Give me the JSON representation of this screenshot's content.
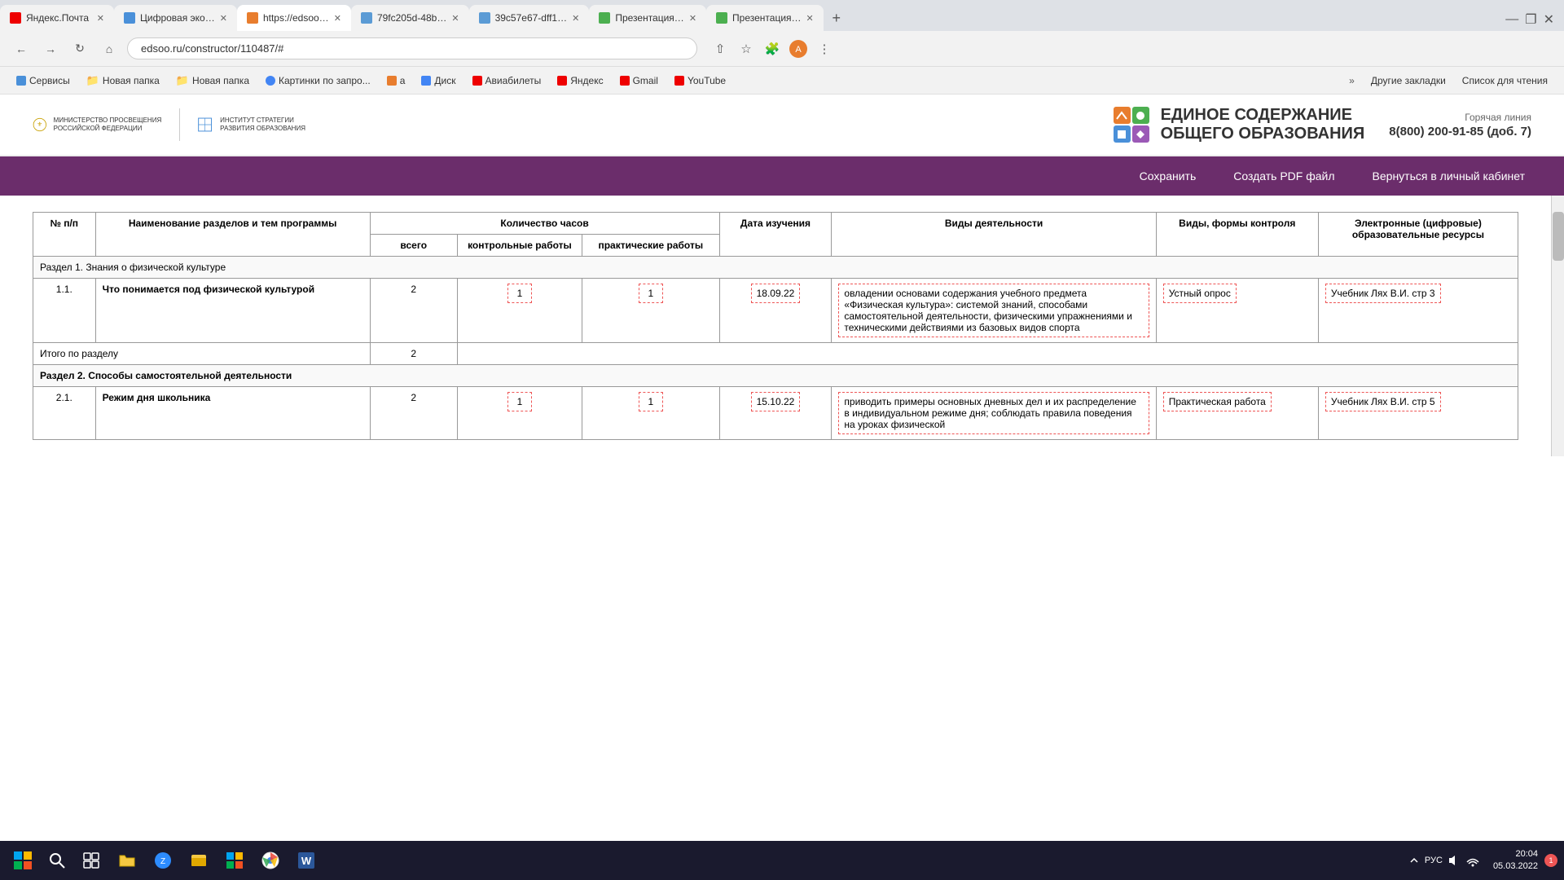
{
  "browser": {
    "tabs": [
      {
        "id": 1,
        "title": "Яндекс.Почта",
        "active": false,
        "favicon_color": "#e00"
      },
      {
        "id": 2,
        "title": "Цифровая эко…",
        "active": false,
        "favicon_color": "#4a90d9"
      },
      {
        "id": 3,
        "title": "https://edsoo…",
        "active": true,
        "favicon_color": "#e87d2e"
      },
      {
        "id": 4,
        "title": "79fc205d-48b…",
        "active": false,
        "favicon_color": "#5b9bd5"
      },
      {
        "id": 5,
        "title": "39c57e67-dff1…",
        "active": false,
        "favicon_color": "#5b9bd5"
      },
      {
        "id": 6,
        "title": "Презентация…",
        "active": false,
        "favicon_color": "#4caf50"
      },
      {
        "id": 7,
        "title": "Презентация…",
        "active": false,
        "favicon_color": "#4caf50"
      }
    ],
    "address": "edsoo.ru/constructor/110487/#",
    "bookmarks": [
      {
        "label": "Сервисы",
        "icon_color": "#4a90d9"
      },
      {
        "label": "Новая папка",
        "icon_color": "#f5c842"
      },
      {
        "label": "Новая папка",
        "icon_color": "#f5c842"
      },
      {
        "label": "Картинки по запро...",
        "icon_color": "#4285f4"
      },
      {
        "label": "a",
        "icon_color": "#e87d2e"
      },
      {
        "label": "Диск",
        "icon_color": "#4285f4"
      },
      {
        "label": "Авиабилеты",
        "icon_color": "#e00"
      },
      {
        "label": "Яндекс",
        "icon_color": "#e00"
      },
      {
        "label": "Gmail",
        "icon_color": "#e00"
      },
      {
        "label": "YouTube",
        "icon_color": "#e00"
      }
    ],
    "bookmarks_more": "»",
    "other_bookmarks": "Другие закладки",
    "reading_list": "Список для чтения"
  },
  "site_header": {
    "ministry_logo_text": "МИНИСТЕРСТВО ПРОСВЕЩЕНИЯ РОССИЙСКОЙ ФЕДЕРАЦИИ",
    "institute_logo_text": "ИНСТИТУТ СТРАТЕГИИ РАЗВИТИЯ ОБРАЗОВАНИЯ",
    "brand_title_line1": "ЕДИНОЕ СОДЕРЖАНИЕ",
    "brand_title_line2": "ОБЩЕГО ОБРАЗОВАНИЯ",
    "hotline_label": "Горячая линия",
    "hotline_number": "8(800) 200-91-85",
    "hotline_ext": "(доб. 7)"
  },
  "nav": {
    "save": "Сохранить",
    "pdf": "Создать PDF файл",
    "cabinet": "Вернуться в личный кабинет"
  },
  "table": {
    "headers": {
      "num": "№ п/п",
      "name": "Наименование разделов и тем программы",
      "hours_total_group": "Количество часов",
      "hours_total": "всего",
      "hours_control": "контрольные работы",
      "hours_practice": "практические работы",
      "date": "Дата изучения",
      "activities": "Виды деятельности",
      "control_forms": "Виды, формы контроля",
      "digital_resources": "Электронные (цифровые) образовательные ресурсы"
    },
    "section1": {
      "title": "Раздел 1. Знания о физической культуре",
      "rows": [
        {
          "num": "1.1.",
          "name": "Что понимается под физической культурой",
          "hours_total": "2",
          "hours_control": "1",
          "hours_practice": "1",
          "date": "18.09.22",
          "activities": "овладении основами содержания учебного предмета «Физическая культура»: системой знаний, способами самостоятельной деятельности, физическими упражнениями и техническими действиями из базовых видов спорта",
          "control_forms": "Устный опрос",
          "digital_resources": "Учебник Лях В.И. стр 3"
        }
      ],
      "total_label": "Итого по разделу",
      "total_hours": "2"
    },
    "section2": {
      "title": "Раздел 2. Способы самостоятельной деятельности",
      "rows": [
        {
          "num": "2.1.",
          "name": "Режим дня школьника",
          "hours_total": "2",
          "hours_control": "1",
          "hours_practice": "1",
          "date": "15.10.22",
          "activities": "приводить примеры основных дневных дел и их распределение в индивидуальном режиме дня;\n\nсоблюдать правила поведения на уроках физической",
          "control_forms": "Практическая работа",
          "digital_resources": "Учебник Лях В.И. стр 5"
        }
      ]
    }
  },
  "taskbar": {
    "time": "20:04",
    "date": "05.03.2022",
    "lang": "РУС",
    "notification_count": "1"
  }
}
